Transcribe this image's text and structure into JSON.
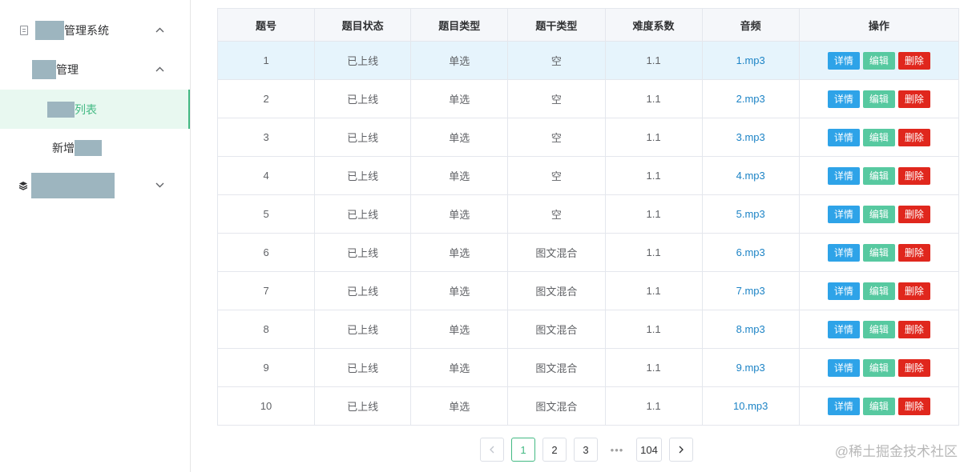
{
  "sidebar": {
    "system_label": "管理系统",
    "group_label": "管理",
    "active_item_label": "列表",
    "add_item_label": "新增"
  },
  "table": {
    "headers": [
      "题号",
      "题目状态",
      "题目类型",
      "题干类型",
      "难度系数",
      "音频",
      "操作"
    ],
    "rows": [
      {
        "no": "1",
        "status": "已上线",
        "type": "单选",
        "stem": "空",
        "difficulty": "1.1",
        "audio": "1.mp3"
      },
      {
        "no": "2",
        "status": "已上线",
        "type": "单选",
        "stem": "空",
        "difficulty": "1.1",
        "audio": "2.mp3"
      },
      {
        "no": "3",
        "status": "已上线",
        "type": "单选",
        "stem": "空",
        "difficulty": "1.1",
        "audio": "3.mp3"
      },
      {
        "no": "4",
        "status": "已上线",
        "type": "单选",
        "stem": "空",
        "difficulty": "1.1",
        "audio": "4.mp3"
      },
      {
        "no": "5",
        "status": "已上线",
        "type": "单选",
        "stem": "空",
        "difficulty": "1.1",
        "audio": "5.mp3"
      },
      {
        "no": "6",
        "status": "已上线",
        "type": "单选",
        "stem": "图文混合",
        "difficulty": "1.1",
        "audio": "6.mp3"
      },
      {
        "no": "7",
        "status": "已上线",
        "type": "单选",
        "stem": "图文混合",
        "difficulty": "1.1",
        "audio": "7.mp3"
      },
      {
        "no": "8",
        "status": "已上线",
        "type": "单选",
        "stem": "图文混合",
        "difficulty": "1.1",
        "audio": "8.mp3"
      },
      {
        "no": "9",
        "status": "已上线",
        "type": "单选",
        "stem": "图文混合",
        "difficulty": "1.1",
        "audio": "9.mp3"
      },
      {
        "no": "10",
        "status": "已上线",
        "type": "单选",
        "stem": "图文混合",
        "difficulty": "1.1",
        "audio": "10.mp3"
      }
    ],
    "actions": {
      "detail": "详情",
      "edit": "编辑",
      "delete": "删除"
    }
  },
  "pagination": {
    "prev_icon": "chevron-left-icon",
    "pages": [
      "1",
      "2",
      "3"
    ],
    "ellipsis": "•••",
    "last_page": "104",
    "current": "1",
    "next_icon": "chevron-right-icon"
  },
  "watermark": "@稀土掘金技术社区",
  "colors": {
    "accent": "#42b983",
    "detail": "#2ea3e8",
    "edit": "#57c9a0",
    "delete": "#e0271d",
    "link": "#1d84c6",
    "highlight_row": "#e6f4fc"
  }
}
